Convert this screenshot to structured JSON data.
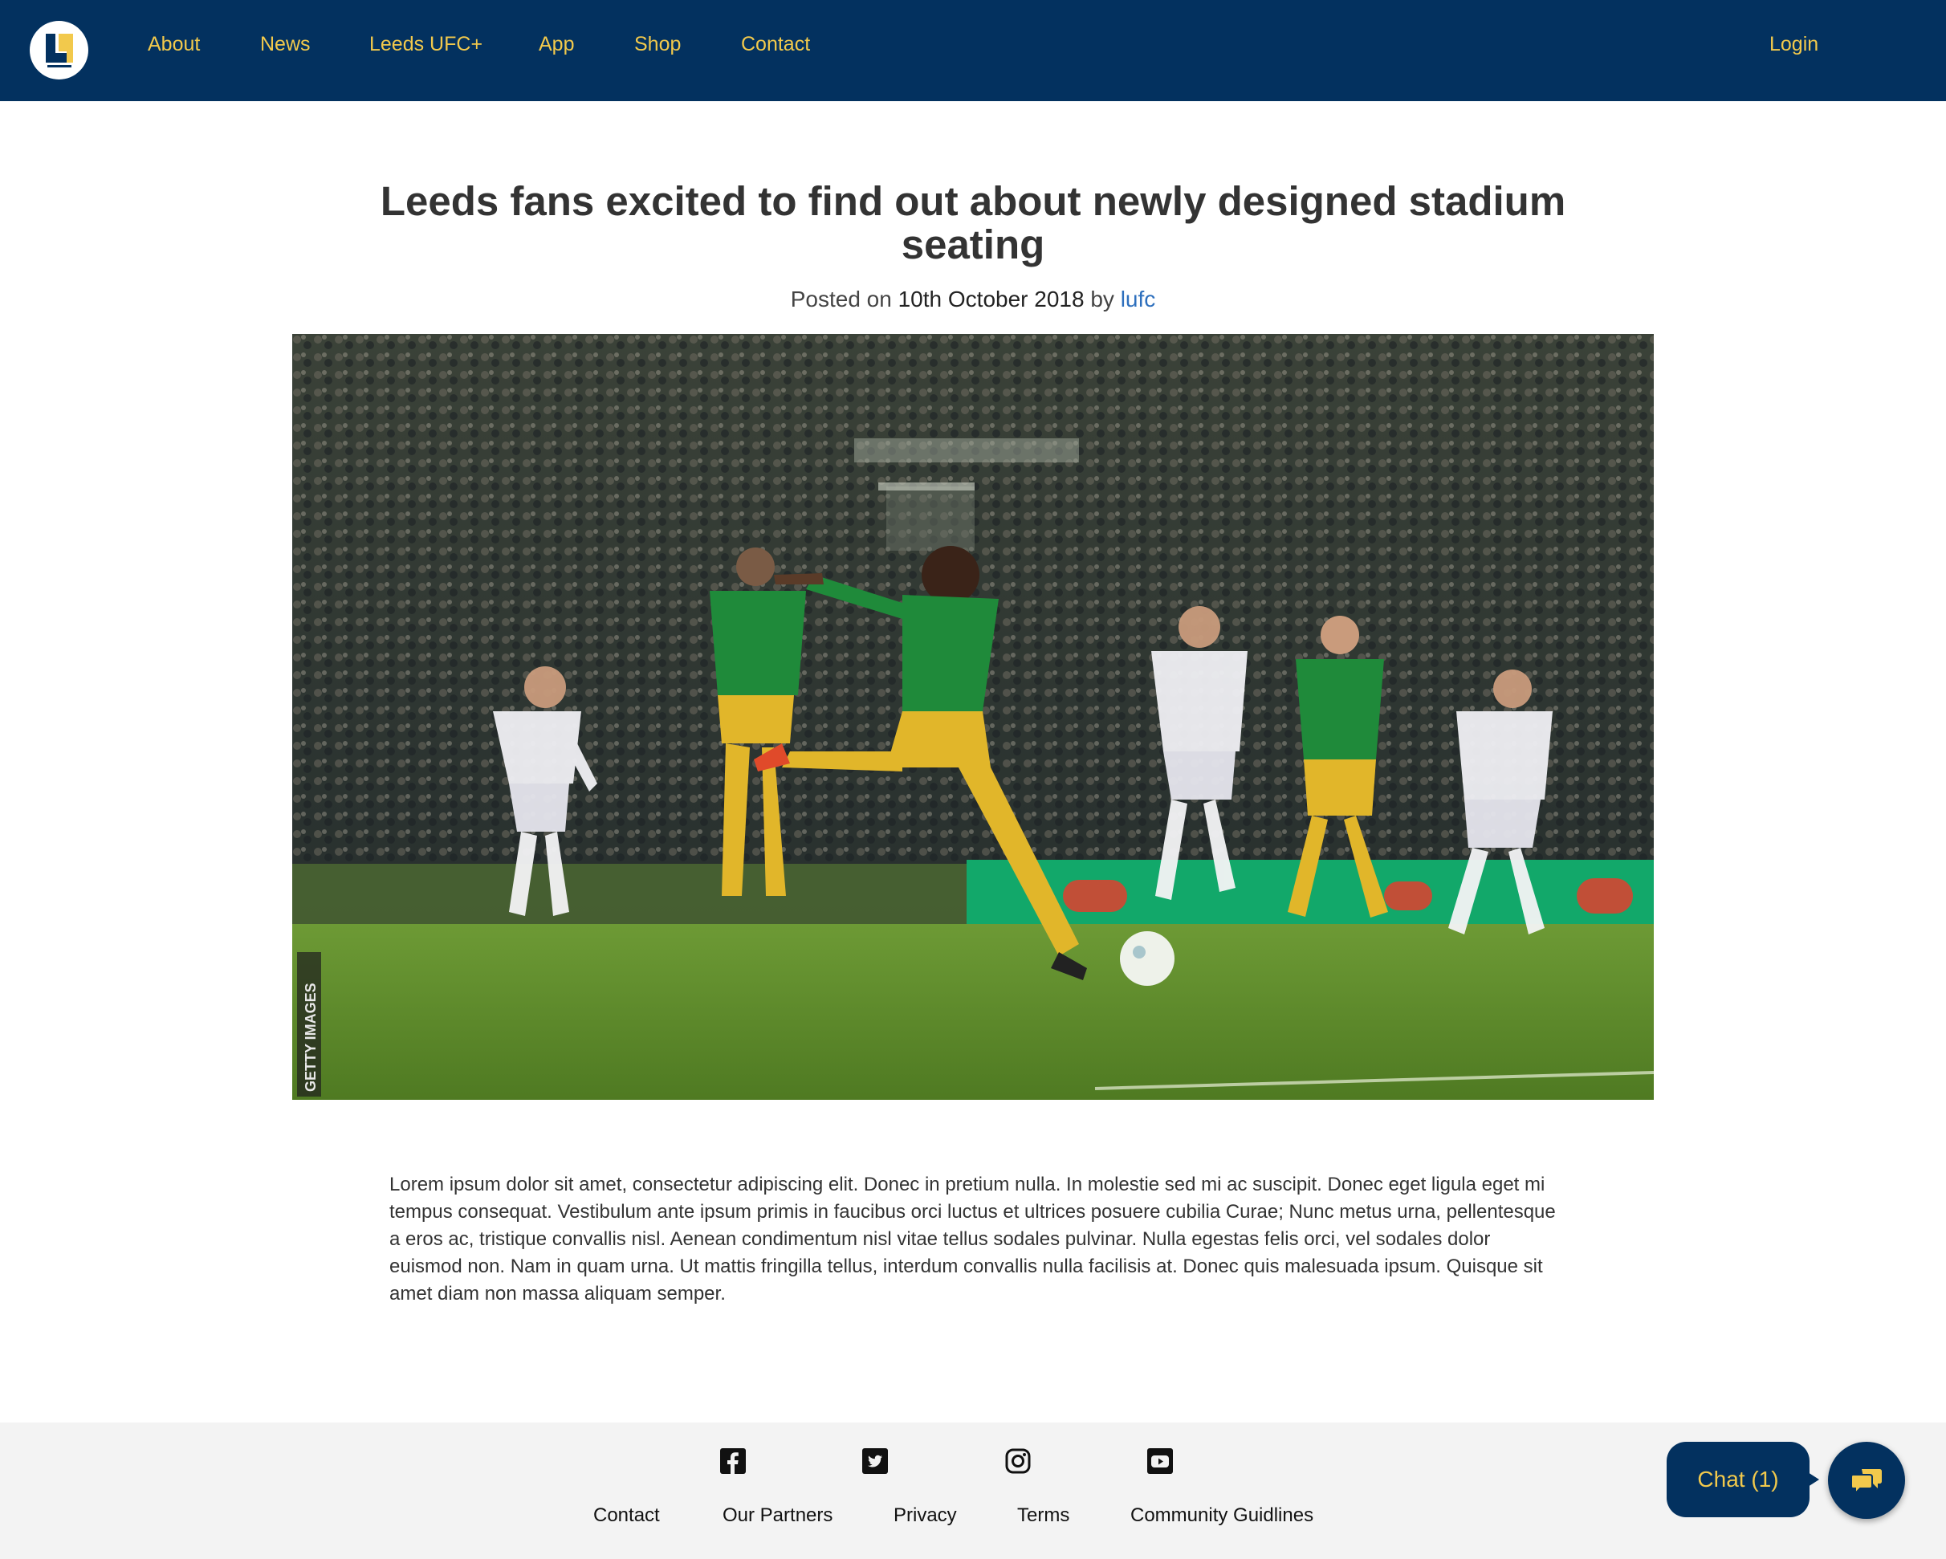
{
  "header": {
    "logo_icon": "leeds-united-logo",
    "nav": [
      "About",
      "News",
      "Leeds UFC+",
      "App",
      "Shop",
      "Contact"
    ],
    "login": "Login"
  },
  "article": {
    "title": "Leeds fans excited to find out about newly designed stadium seating",
    "posted_on": "Posted on",
    "date": "10th October 2018",
    "by": "by",
    "author": "lufc",
    "image_credit": "GETTY IMAGES",
    "body": "Lorem ipsum dolor sit amet, consectetur adipiscing elit. Donec in pretium nulla. In molestie sed mi ac suscipit. Donec eget ligula eget mi tempus consequat. Vestibulum ante ipsum primis in faucibus orci luctus et ultrices posuere cubilia Curae; Nunc metus urna, pellentesque a eros ac, tristique convallis nisl. Aenean condimentum nisl vitae tellus sodales pulvinar. Nulla egestas felis orci, vel sodales dolor euismod non. Nam in quam urna. Ut mattis fringilla tellus, interdum convallis nulla facilisis at. Donec quis malesuada ipsum. Quisque sit amet diam non massa aliquam semper."
  },
  "footer": {
    "social_icons": [
      "facebook-icon",
      "twitter-icon",
      "instagram-icon",
      "youtube-icon"
    ],
    "links": [
      "Contact",
      "Our Partners",
      "Privacy",
      "Terms",
      "Community Guidlines"
    ]
  },
  "chat": {
    "label": "Chat (1)",
    "icon": "chat-bubbles-icon"
  },
  "colors": {
    "brand_navy": "#03315f",
    "brand_yellow": "#f2c94c",
    "link_blue": "#2d6fbd",
    "footer_bg": "#f3f3f3"
  }
}
